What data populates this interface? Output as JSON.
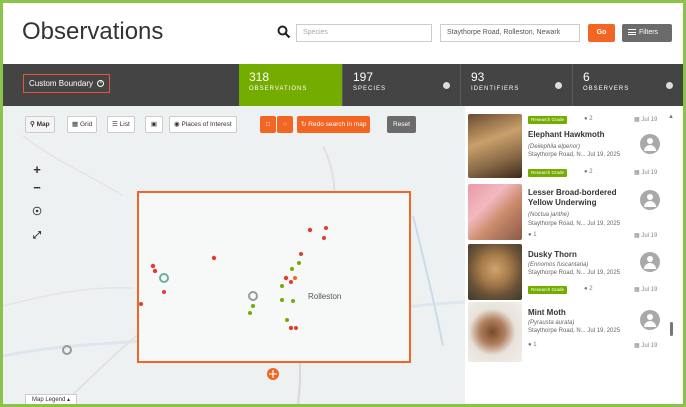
{
  "header": {
    "title": "Observations",
    "species_placeholder": "Species",
    "place_value": "Staythorpe Road, Rolleston, Newark",
    "go_label": "Go",
    "filters_label": "Filters"
  },
  "stats": {
    "boundary_label": "Custom Boundary",
    "observations": {
      "count": "318",
      "label": "OBSERVATIONS"
    },
    "species": {
      "count": "197",
      "label": "SPECIES"
    },
    "identifiers": {
      "count": "93",
      "label": "IDENTIFIERS"
    },
    "observers": {
      "count": "6",
      "label": "OBSERVERS"
    }
  },
  "map": {
    "toolbar": {
      "map": "Map",
      "grid": "Grid",
      "list": "List",
      "places": "Places of Interest",
      "redo": "Redo search in map",
      "reset": "Reset"
    },
    "labels": {
      "rolleston": "Rolleston"
    },
    "legend": "Map Legend"
  },
  "observations": [
    {
      "name": "",
      "scientific": "",
      "location": "",
      "grade": "Research Grade",
      "ids": "2",
      "date": "Jul 19"
    },
    {
      "name": "Elephant Hawkmoth",
      "scientific": "(Deilephila elpenor)",
      "location": "Staythorpe Road, N... Jul 19, 2025",
      "grade": "Research Grade",
      "ids": "2",
      "date": "Jul 19"
    },
    {
      "name": "Lesser Broad-bordered Yellow Underwing",
      "scientific": "(Noctua janthe)",
      "location": "Staythorpe Road, N... Jul 19, 2025",
      "grade": "",
      "ids": "1",
      "date": "Jul 19"
    },
    {
      "name": "Dusky Thorn",
      "scientific": "(Ennomos fuscantaria)",
      "location": "Staythorpe Road, N... Jul 19, 2025",
      "grade": "Research Grade",
      "ids": "2",
      "date": "Jul 19"
    },
    {
      "name": "Mint Moth",
      "scientific": "(Pyrausta aurata)",
      "location": "Staythorpe Road, N... Jul 19, 2025",
      "grade": "",
      "ids": "1",
      "date": "Jul 19"
    }
  ],
  "colors": {
    "accent_green": "#74ac00",
    "accent_orange": "#f26522",
    "stats_bg": "#444444"
  }
}
